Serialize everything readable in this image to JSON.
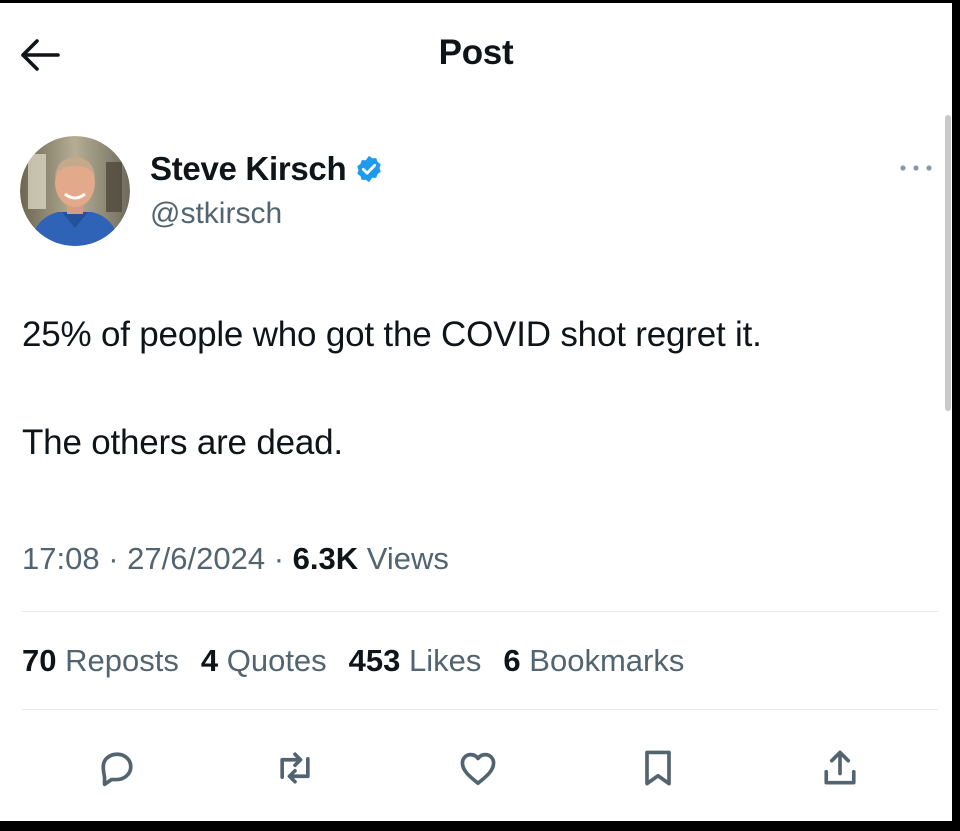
{
  "header": {
    "back_icon": "arrow-left-icon",
    "title": "Post"
  },
  "author": {
    "name": "Steve Kirsch",
    "handle": "@stkirsch",
    "verified_icon": "verified-badge-icon",
    "verified_color": "#1d9bf0"
  },
  "post": {
    "lines": [
      "25% of people who got the COVID shot regret it.",
      "The others are dead."
    ],
    "time": "17:08",
    "date": "27/6/2024",
    "separator": "·",
    "views_count": "6.3K",
    "views_label": "Views"
  },
  "stats": [
    {
      "count": "70",
      "label": "Reposts"
    },
    {
      "count": "4",
      "label": "Quotes"
    },
    {
      "count": "453",
      "label": "Likes"
    },
    {
      "count": "6",
      "label": "Bookmarks"
    }
  ],
  "actions": [
    {
      "icon": "reply-icon"
    },
    {
      "icon": "repost-icon"
    },
    {
      "icon": "like-icon"
    },
    {
      "icon": "bookmark-icon"
    },
    {
      "icon": "share-icon"
    }
  ],
  "colors": {
    "text": "#0f1419",
    "secondary_text": "#536471",
    "divider": "#e6e8ea",
    "accent": "#1d9bf0"
  }
}
